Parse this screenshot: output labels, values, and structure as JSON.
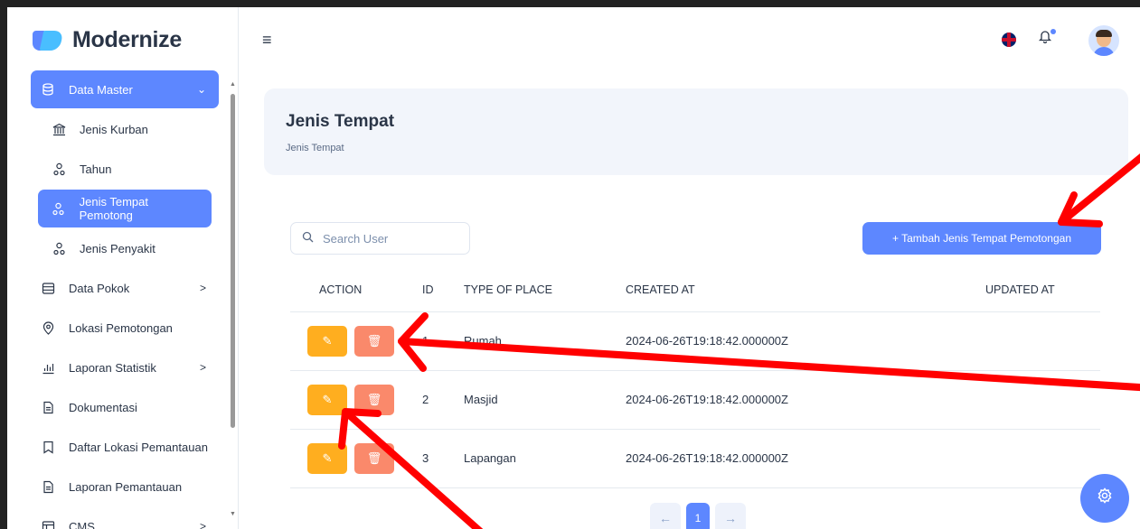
{
  "brand": {
    "name": "Modernize"
  },
  "sidebar": {
    "items": [
      {
        "label": "Data Master",
        "icon": "database-icon",
        "active": true,
        "expanded": true
      },
      {
        "label": "Jenis Kurban",
        "icon": "bank-icon",
        "sub": true
      },
      {
        "label": "Tahun",
        "icon": "users-icon",
        "sub": true
      },
      {
        "label": "Jenis Tempat Pemotong",
        "icon": "users-icon",
        "sub": true,
        "active": true
      },
      {
        "label": "Jenis Penyakit",
        "icon": "users-icon",
        "sub": true
      },
      {
        "label": "Data Pokok",
        "icon": "server-icon",
        "chevron": ">"
      },
      {
        "label": "Lokasi Pemotongan",
        "icon": "map-pin-icon"
      },
      {
        "label": "Laporan Statistik",
        "icon": "chart-icon",
        "chevron": ">"
      },
      {
        "label": "Dokumentasi",
        "icon": "document-icon"
      },
      {
        "label": "Daftar Lokasi Pemantauan",
        "icon": "bookmark-icon"
      },
      {
        "label": "Laporan Pemantauan",
        "icon": "document-icon"
      },
      {
        "label": "CMS",
        "icon": "layout-icon",
        "chevron": ">"
      }
    ]
  },
  "header": {
    "menu_icon": "≡"
  },
  "page": {
    "title": "Jenis Tempat",
    "breadcrumb": "Jenis Tempat"
  },
  "search": {
    "placeholder": "Search User"
  },
  "add_button": {
    "label": "+ Tambah Jenis Tempat Pemotongan"
  },
  "table": {
    "headers": [
      "ACTION",
      "ID",
      "TYPE OF PLACE",
      "CREATED AT",
      "UPDATED AT"
    ],
    "rows": [
      {
        "id": "1",
        "type": "Rumah",
        "created": "2024-06-26T19:18:42.000000Z",
        "updated": ""
      },
      {
        "id": "2",
        "type": "Masjid",
        "created": "2024-06-26T19:18:42.000000Z",
        "updated": ""
      },
      {
        "id": "3",
        "type": "Lapangan",
        "created": "2024-06-26T19:18:42.000000Z",
        "updated": ""
      }
    ]
  },
  "pagination": {
    "prev": "←",
    "current": "1",
    "next": "→"
  },
  "colors": {
    "primary": "#5d87ff",
    "warning": "#ffae1f",
    "danger": "#fa896b",
    "annotation": "#ff0000"
  }
}
